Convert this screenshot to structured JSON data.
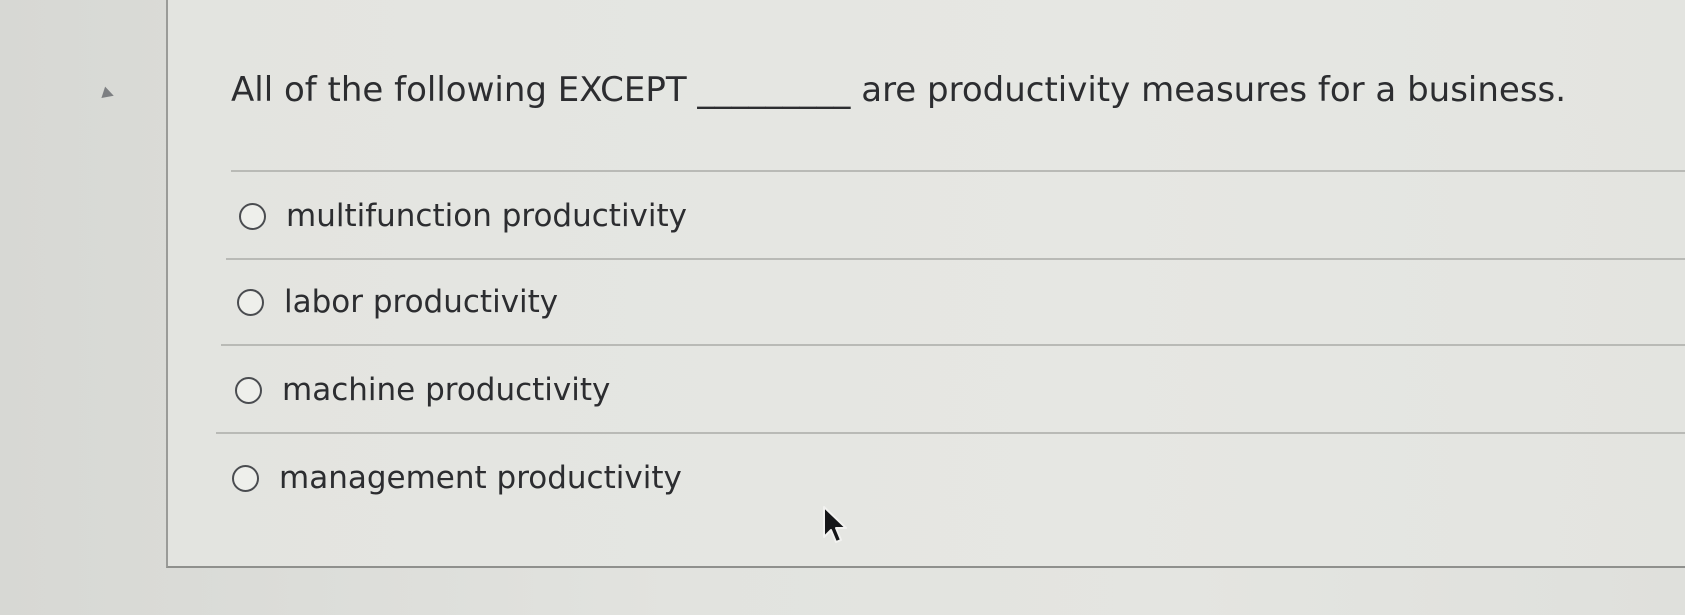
{
  "question": {
    "prompt_before": "All of the following EXCEPT",
    "blank": "_________",
    "prompt_after": "are productivity measures for a business."
  },
  "options": [
    {
      "label": "multifunction productivity",
      "selected": false
    },
    {
      "label": "labor productivity",
      "selected": false
    },
    {
      "label": "machine productivity",
      "selected": false
    },
    {
      "label": "management productivity",
      "selected": false
    }
  ],
  "icons": {
    "collapse_marker": "caret-right-icon",
    "radio": "radio-unselected-icon",
    "cursor": "mouse-pointer-icon"
  }
}
